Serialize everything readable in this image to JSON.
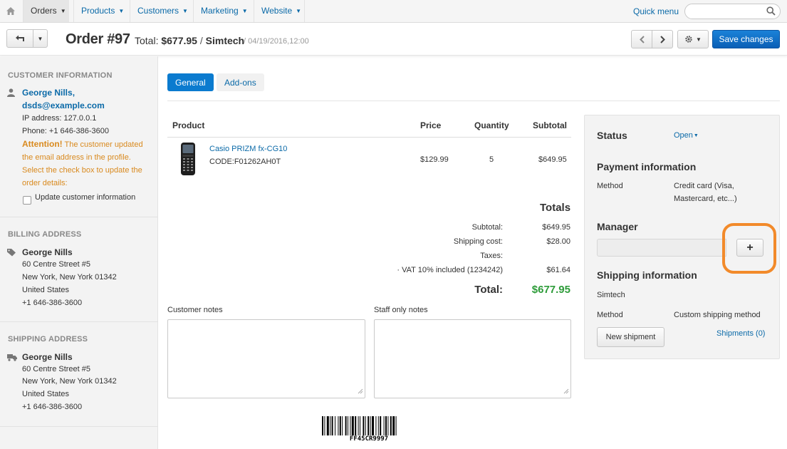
{
  "nav": {
    "items": [
      {
        "label": "Orders",
        "active": true
      },
      {
        "label": "Products",
        "active": false
      },
      {
        "label": "Customers",
        "active": false
      },
      {
        "label": "Marketing",
        "active": false
      },
      {
        "label": "Website",
        "active": false
      }
    ],
    "quick_menu": "Quick menu",
    "search_placeholder": ""
  },
  "header": {
    "title": "Order #97",
    "total_label": "Total:",
    "total_value": "$677.95",
    "separator": "/",
    "company": "Simtech",
    "date": "/ 04/19/2016,12:00",
    "save_label": "Save changes"
  },
  "sidebar": {
    "customer": {
      "heading": "Customer information",
      "name": "George Nills,",
      "email": "dsds@example.com",
      "ip": "IP address: 127.0.0.1",
      "phone": "Phone: +1 646-386-3600",
      "attention_label": "Attention!",
      "attention_text": "The customer updated the email address in the profile. Select the check box to update the order details:",
      "checkbox_label": "Update customer information"
    },
    "billing": {
      "heading": "Billing address",
      "name": "George Nills",
      "street": "60 Centre Street #5",
      "city": "New York, New York 01342",
      "country": "United States",
      "phone": "+1 646-386-3600"
    },
    "shipping": {
      "heading": "Shipping address",
      "name": "George Nills",
      "street": "60 Centre Street #5",
      "city": "New York, New York 01342",
      "country": "United States",
      "phone": "+1 646-386-3600"
    }
  },
  "tabs": [
    {
      "label": "General",
      "active": true
    },
    {
      "label": "Add-ons",
      "active": false
    }
  ],
  "products": {
    "columns": [
      "Product",
      "Price",
      "Quantity",
      "Subtotal"
    ],
    "rows": [
      {
        "name": "Casio PRIZM fx-CG10",
        "code": "CODE:F01262AH0T",
        "price": "$129.99",
        "quantity": "5",
        "subtotal": "$649.95"
      }
    ]
  },
  "totals": {
    "heading": "Totals",
    "subtotal_label": "Subtotal:",
    "subtotal_value": "$649.95",
    "shipping_label": "Shipping cost:",
    "shipping_value": "$28.00",
    "taxes_label": "Taxes:",
    "vat_label": "· VAT 10% included (1234242)",
    "vat_value": "$61.64",
    "total_label": "Total:",
    "total_value": "$677.95",
    "total_color": "#2e9c3a"
  },
  "notes": {
    "customer_label": "Customer notes",
    "customer_value": "",
    "staff_label": "Staff only notes",
    "staff_value": ""
  },
  "barcode": {
    "text": "FF45CR9997"
  },
  "panel": {
    "status_heading": "Status",
    "status_value": "Open",
    "payment_heading": "Payment information",
    "method_label": "Method",
    "payment_method_line1": "Credit card (Visa,",
    "payment_method_line2": "Mastercard, etc...)",
    "manager_heading": "Manager",
    "manager_value": "",
    "manager_add": "+",
    "shipping_heading": "Shipping information",
    "shipping_company": "Simtech",
    "shipping_method_label": "Method",
    "shipping_method_value": "Custom shipping method",
    "new_shipment_label": "New shipment",
    "shipments_link": "Shipments (0)"
  },
  "colors": {
    "accent": "#0b7bcf",
    "link": "#0b6aa8",
    "attention": "#d98a1f",
    "highlight": "#f28a2a"
  }
}
